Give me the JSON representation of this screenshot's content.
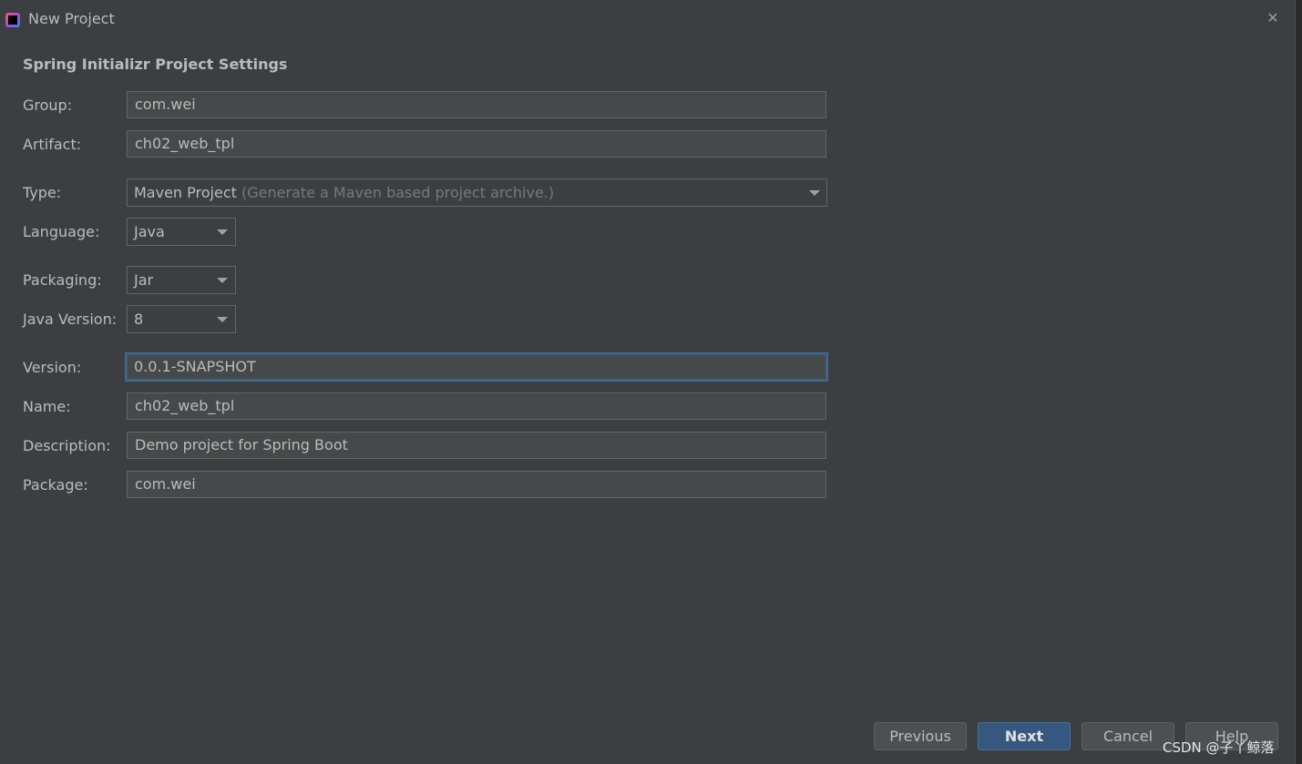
{
  "window": {
    "title": "New Project",
    "icon": "intellij-idea-icon",
    "close_glyph": "✕"
  },
  "section": {
    "title": "Spring Initializr Project Settings"
  },
  "fields": {
    "group": {
      "label": "Group:",
      "value": "com.wei"
    },
    "artifact": {
      "label": "Artifact:",
      "value": "ch02_web_tpl"
    },
    "type": {
      "label": "Type:",
      "value": "Maven Project",
      "hint": "(Generate a Maven based project archive.)"
    },
    "language": {
      "label": "Language:",
      "value": "Java"
    },
    "packaging": {
      "label": "Packaging:",
      "value": "Jar"
    },
    "java_version": {
      "label": "Java Version:",
      "value": "8"
    },
    "version": {
      "label": "Version:",
      "value": "0.0.1-SNAPSHOT"
    },
    "name": {
      "label": "Name:",
      "value": "ch02_web_tpl"
    },
    "description": {
      "label": "Description:",
      "value": "Demo project for Spring Boot"
    },
    "package": {
      "label": "Package:",
      "value": "com.wei"
    }
  },
  "buttons": {
    "previous": "Previous",
    "next": "Next",
    "cancel": "Cancel",
    "help": "Help"
  },
  "watermark": "CSDN @子丫鲸落",
  "colors": {
    "background": "#3c3f41",
    "field_background": "#45494a",
    "focus_border": "#3d6185",
    "primary_button": "#365880"
  }
}
